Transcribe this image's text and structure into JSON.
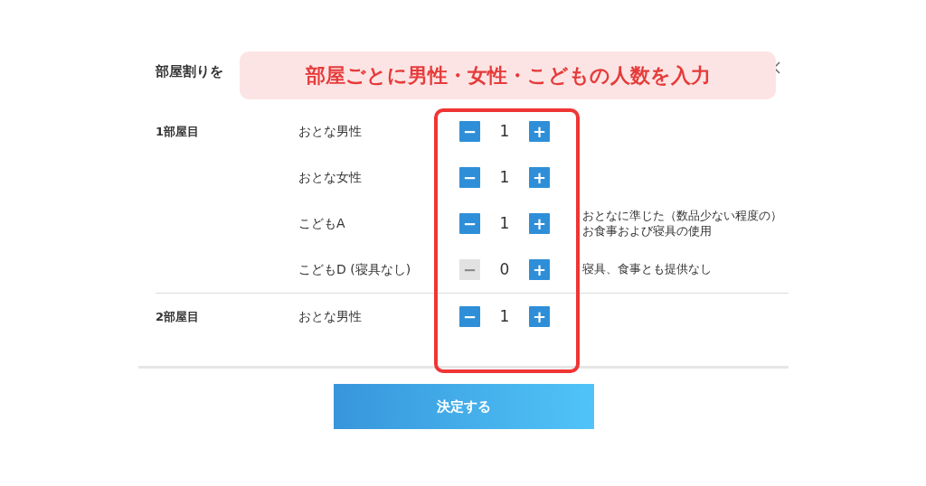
{
  "header": {
    "title": "部屋割りを"
  },
  "callout": {
    "text": "部屋ごとに男性・女性・こどもの人数を入力"
  },
  "rooms": [
    {
      "label": "1部屋目",
      "guests": [
        {
          "label": "おとな男性",
          "count": "1",
          "minus": "−",
          "plus": "+",
          "minus_disabled": false
        },
        {
          "label": "おとな女性",
          "count": "1",
          "minus": "−",
          "plus": "+",
          "minus_disabled": false
        },
        {
          "label": "こどもA",
          "count": "1",
          "minus": "−",
          "plus": "+",
          "minus_disabled": false,
          "note": "おとなに準じた（数品少ない程度の）お食事および寝具の使用"
        },
        {
          "label": "こどもD (寝具なし)",
          "count": "0",
          "minus": "−",
          "plus": "+",
          "minus_disabled": true,
          "note": "寝具、食事とも提供なし"
        }
      ]
    },
    {
      "label": "2部屋目",
      "guests": [
        {
          "label": "おとな男性",
          "count": "1",
          "minus": "−",
          "plus": "+",
          "minus_disabled": false
        }
      ]
    }
  ],
  "submit_button": {
    "label": "決定する"
  }
}
